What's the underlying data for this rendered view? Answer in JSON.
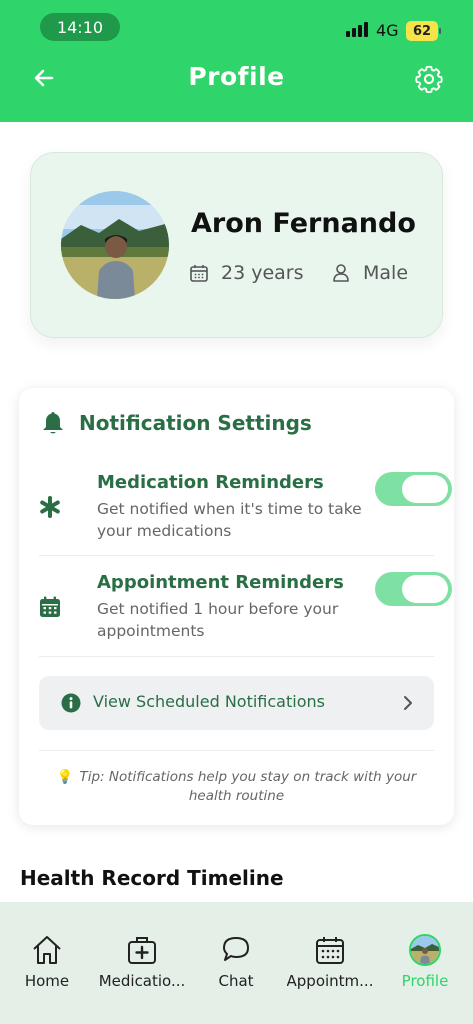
{
  "status_bar": {
    "time": "14:10",
    "network": "4G",
    "battery": "62"
  },
  "header": {
    "title": "Profile"
  },
  "profile": {
    "name": "Aron Fernando",
    "age": "23 years",
    "gender": "Male"
  },
  "notification_settings": {
    "title": "Notification Settings",
    "items": [
      {
        "title": "Medication Reminders",
        "description": "Get notified when it's time to take your medications",
        "enabled": true,
        "icon": "asterisk-icon"
      },
      {
        "title": "Appointment Reminders",
        "description": "Get notified 1 hour before your appointments",
        "enabled": true,
        "icon": "calendar-icon"
      }
    ],
    "view_button": "View Scheduled Notifications",
    "tip": "Tip: Notifications help you stay on track with your health routine"
  },
  "section_heading": "Health Record Timeline",
  "nav": {
    "items": [
      {
        "label": "Home",
        "icon": "home-icon"
      },
      {
        "label": "Medicatio...",
        "icon": "medical-bag-icon"
      },
      {
        "label": "Chat",
        "icon": "chat-icon"
      },
      {
        "label": "Appointm...",
        "icon": "calendar-icon"
      },
      {
        "label": "Profile",
        "icon": "avatar"
      }
    ],
    "active": "Profile"
  },
  "colors": {
    "primary": "#2fd46a",
    "accent_text": "#2a6e45",
    "nav_bg": "#e3efe7"
  }
}
